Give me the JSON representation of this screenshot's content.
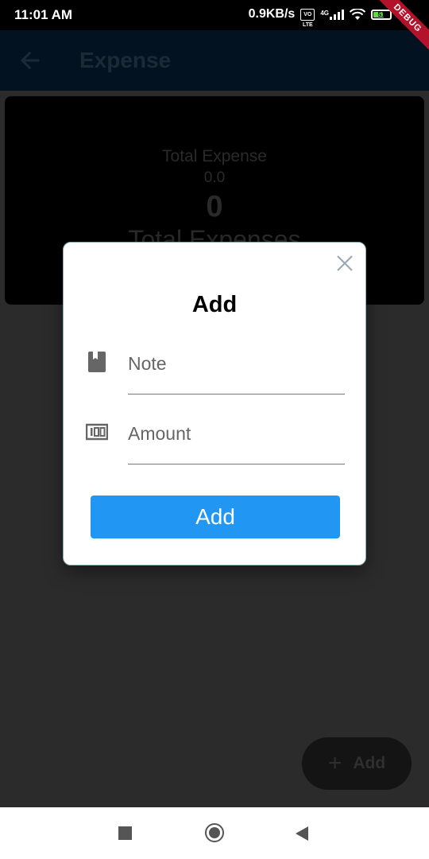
{
  "status_bar": {
    "time": "11:01 AM",
    "network_speed": "0.9KB/s",
    "volte_badge": "VO LTE",
    "network_type": "4G",
    "battery_level": "51",
    "debug_banner": "DEBUG"
  },
  "app_bar": {
    "back_icon": "arrow-left-icon",
    "title": "Expense"
  },
  "summary": {
    "label": "Total Expense",
    "value": "0.0",
    "count": "0",
    "subtitle": "Total Expenses"
  },
  "dialog": {
    "title": "Add",
    "note_placeholder": "Note",
    "amount_placeholder": "Amount",
    "add_button_label": "Add",
    "button_color": "#2196f3",
    "close_icon": "close-icon",
    "note_icon": "book-icon",
    "amount_icon": "money-icon"
  },
  "fab": {
    "icon": "plus-icon",
    "label": "Add"
  },
  "nav_bar": {
    "recents_icon": "square-icon",
    "home_icon": "circle-icon",
    "back_icon": "triangle-back-icon"
  }
}
